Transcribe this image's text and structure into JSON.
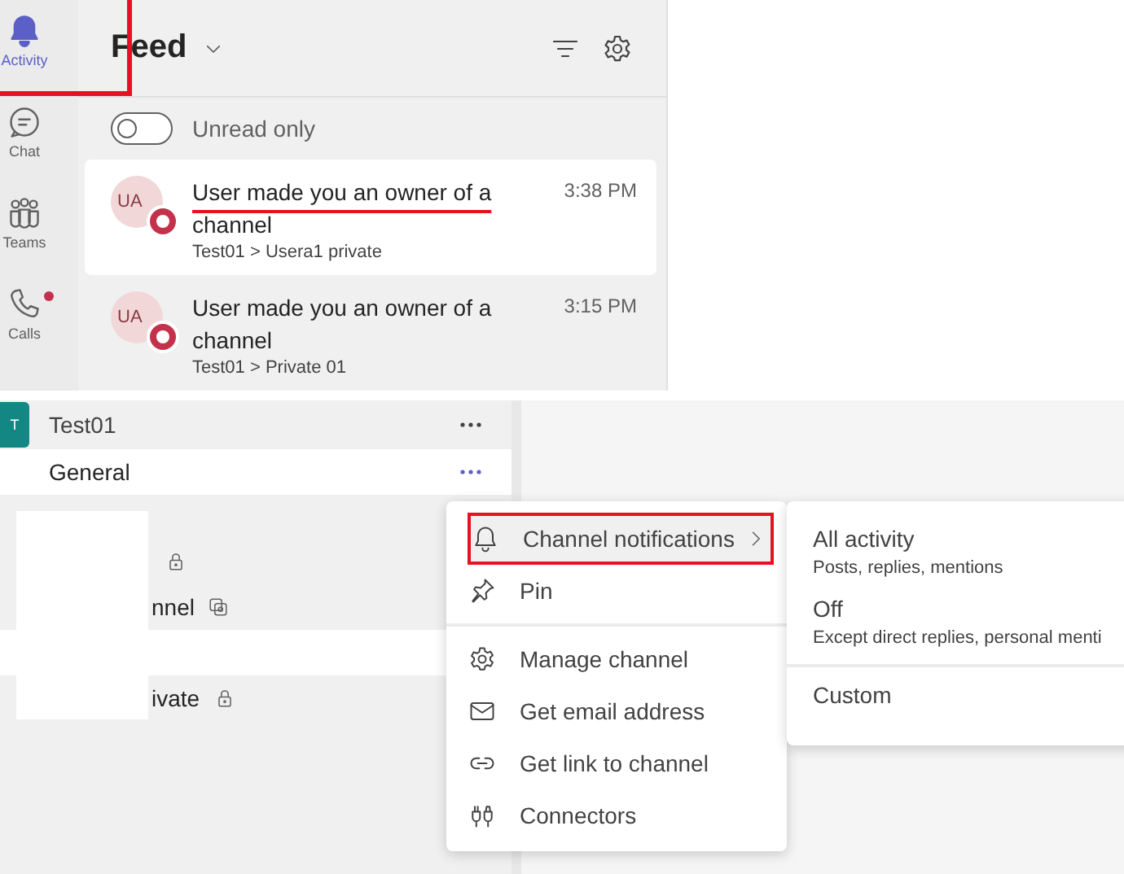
{
  "rail": [
    {
      "label": "Activity",
      "selected": true,
      "annotated": true,
      "badge": false
    },
    {
      "label": "Chat",
      "selected": false,
      "annotated": false,
      "badge": false
    },
    {
      "label": "Teams",
      "selected": false,
      "annotated": false,
      "badge": false
    },
    {
      "label": "Calls",
      "selected": false,
      "annotated": false,
      "badge": true
    }
  ],
  "feed": {
    "title": "Feed",
    "toggle": {
      "label": "Unread only",
      "on": false
    },
    "items": [
      {
        "initials": "UA",
        "text": "User made you an owner of a channel",
        "path": "Test01 > Usera1 private",
        "time": "3:38 PM",
        "selected": true,
        "underlined": true
      },
      {
        "initials": "UA",
        "text": "User made you an owner of a channel",
        "path": "Test01 > Private 01",
        "time": "3:15 PM",
        "selected": false,
        "underlined": false
      }
    ]
  },
  "team": {
    "initials": "T",
    "name": "Test01",
    "channels": [
      {
        "name": "General",
        "kind": "standard",
        "highlighted": true
      },
      {
        "kind": "private",
        "highlighted": false
      },
      {
        "name": "nnel",
        "kind": "shared",
        "highlighted": false
      },
      {
        "kind": "standard",
        "highlighted": true
      },
      {
        "name": "ivate",
        "kind": "private",
        "highlighted": false
      }
    ]
  },
  "menu": {
    "items": [
      {
        "label": "Channel notifications",
        "submenu": true,
        "selected": true,
        "annotated": true,
        "divider_before": false
      },
      {
        "label": "Pin",
        "submenu": false,
        "selected": false,
        "annotated": false,
        "divider_before": false
      },
      {
        "label": "Manage channel",
        "submenu": false,
        "selected": false,
        "annotated": false,
        "divider_before": true
      },
      {
        "label": "Get email address",
        "submenu": false,
        "selected": false,
        "annotated": false,
        "divider_before": false
      },
      {
        "label": "Get link to channel",
        "submenu": false,
        "selected": false,
        "annotated": false,
        "divider_before": false
      },
      {
        "label": "Connectors",
        "submenu": false,
        "selected": false,
        "annotated": false,
        "divider_before": false
      }
    ]
  },
  "submenu": {
    "options": [
      {
        "label": "All activity",
        "description": "Posts, replies, mentions",
        "divider_before": false
      },
      {
        "label": "Off",
        "description": "Except direct replies, personal menti",
        "divider_before": false
      },
      {
        "label": "Custom",
        "divider_before": true
      }
    ]
  }
}
